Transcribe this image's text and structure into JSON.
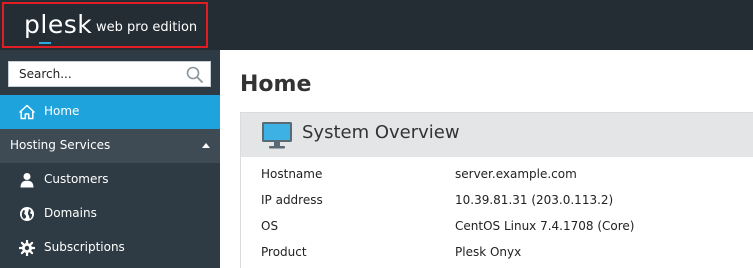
{
  "header": {
    "logo_text": "plesk",
    "edition": "web pro edition",
    "background": "#242d34",
    "highlight_border": "#e31b23"
  },
  "sidebar": {
    "search": {
      "placeholder": "Search...",
      "icon": "search-icon"
    },
    "items": [
      {
        "label": "Home",
        "icon": "home-icon",
        "active": true,
        "color": "#1fa3dc"
      },
      {
        "label": "Hosting Services",
        "type": "section",
        "expanded": true
      },
      {
        "label": "Customers",
        "icon": "user-icon"
      },
      {
        "label": "Domains",
        "icon": "globe-icon"
      },
      {
        "label": "Subscriptions",
        "icon": "gear-icon"
      }
    ]
  },
  "main": {
    "title": "Home",
    "panel": {
      "title": "System Overview",
      "icon": "monitor-icon",
      "rows": [
        {
          "label": "Hostname",
          "value": "server.example.com"
        },
        {
          "label": "IP address",
          "value": "10.39.81.31 (203.0.113.2)"
        },
        {
          "label": "OS",
          "value": "CentOS Linux 7.4.1708 (Core)"
        },
        {
          "label": "Product",
          "value": "Plesk Onyx"
        }
      ]
    }
  }
}
